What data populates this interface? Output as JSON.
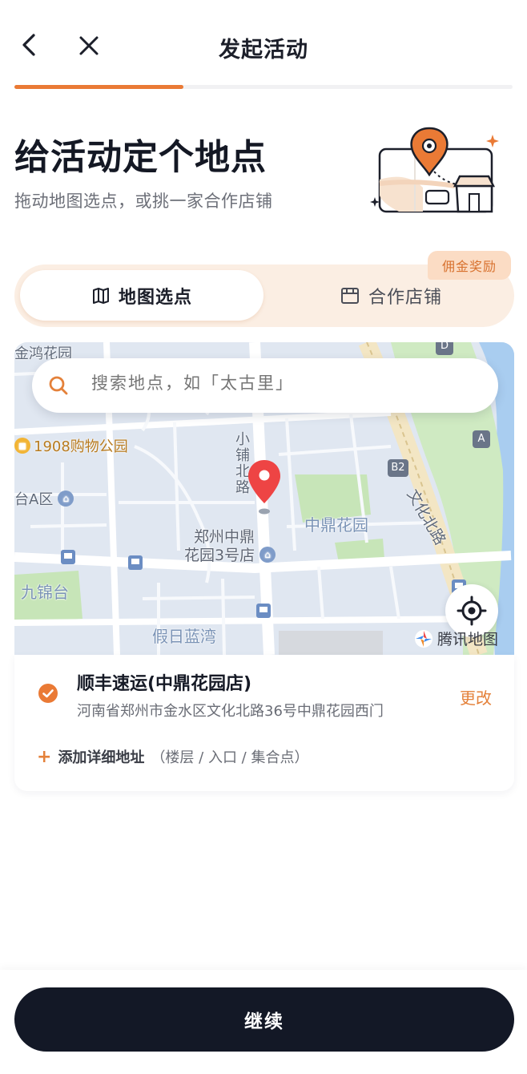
{
  "header": {
    "title": "发起活动",
    "back_icon": "chevron-left-icon",
    "close_icon": "close-icon",
    "progress": 0.34,
    "accent_color": "#ea7a35"
  },
  "intro": {
    "heading": "给活动定个地点",
    "subheading": "拖动地图选点，或挑一家合作店铺"
  },
  "tabs": {
    "map_pick": "地图选点",
    "partner_shops": "合作店铺",
    "partner_badge": "佣金奖励",
    "active": "map_pick"
  },
  "map": {
    "search_placeholder": "搜索地点，如「太古里」",
    "labels": {
      "jinhong": "金鸿花园",
      "mall": "1908购物公园",
      "district_a": "台A区",
      "xiaopu_road": "小铺北路",
      "store": "郑州中鼎",
      "store2": "花园3号店",
      "zhongding": "中鼎花园",
      "jiujin": "九锦台",
      "jiari": "假日蓝湾",
      "wenhua_road": "文化北路",
      "tencent_map": "腾讯地图",
      "marker_b2": "B2",
      "marker_a": "A",
      "marker_d": "D"
    }
  },
  "selected_place": {
    "name": "顺丰速运(中鼎花园店)",
    "address": "河南省郑州市金水区文化北路36号中鼎花园西门",
    "change_label": "更改",
    "add_detail_label": "添加详细地址",
    "add_detail_hint": "（楼层 / 入口 / 集合点）"
  },
  "footer": {
    "continue_label": "继续"
  }
}
